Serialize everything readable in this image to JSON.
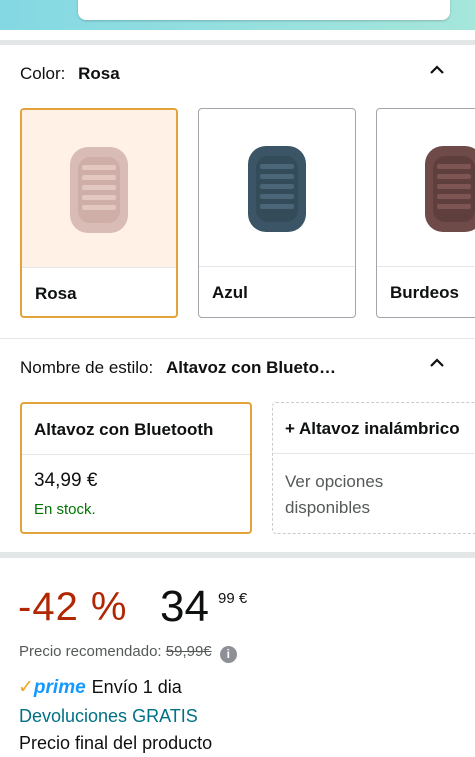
{
  "color_section": {
    "key_label": "Color:",
    "selected_value": "Rosa",
    "swatches": [
      {
        "name": "Rosa",
        "color": "#d9bcb6",
        "bg": "#fff1e6",
        "selected": true
      },
      {
        "name": "Azul",
        "color": "#3c5566",
        "bg": "#ffffff",
        "selected": false
      },
      {
        "name": "Burdeos",
        "color": "#6e4a48",
        "bg": "#ffffff",
        "selected": false
      }
    ]
  },
  "style_section": {
    "key_label": "Nombre de estilo:",
    "selected_value": "Altavoz con Blueto…",
    "options": [
      {
        "title": "Altavoz con Bluetooth",
        "price": "34,99 €",
        "stock": "En stock."
      },
      {
        "title": "+ Altavoz inalámbrico",
        "options_text": "Ver opciones disponibles"
      }
    ]
  },
  "pricing": {
    "discount": "-42 %",
    "price_whole": "34",
    "price_fraction": "99 €",
    "rrp_label": "Precio recomendado:",
    "rrp_value": "59,99€",
    "info_icon": "info-icon"
  },
  "delivery": {
    "prime_text": "prime",
    "delivery_text": "Envío 1 dia",
    "returns_text": "Devoluciones GRATIS",
    "final_price_text": "Precio final del producto"
  },
  "colors": {
    "accent_border": "#e3a33a",
    "discount_red": "#b12704",
    "stock_green": "#007600",
    "link_teal": "#007185",
    "prime_blue": "#1399ff"
  }
}
